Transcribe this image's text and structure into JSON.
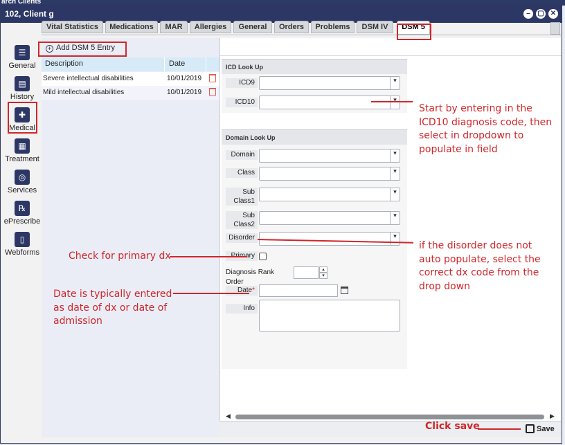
{
  "background": {
    "header_text": "arch Clients"
  },
  "window": {
    "title": "102, Client g"
  },
  "tabs": [
    {
      "label": "Vital Statistics",
      "active": false
    },
    {
      "label": "Medications",
      "active": false
    },
    {
      "label": "MAR",
      "active": false
    },
    {
      "label": "Allergies",
      "active": false
    },
    {
      "label": "General",
      "active": false
    },
    {
      "label": "Orders",
      "active": false
    },
    {
      "label": "Problems",
      "active": false
    },
    {
      "label": "DSM IV",
      "active": false
    },
    {
      "label": "DSM 5",
      "active": true
    }
  ],
  "sidebar": {
    "items": [
      {
        "label": "General",
        "icon": "person-list-icon"
      },
      {
        "label": "History",
        "icon": "clipboard-icon"
      },
      {
        "label": "Medical",
        "icon": "plus-icon"
      },
      {
        "label": "Treatment",
        "icon": "id-card-icon"
      },
      {
        "label": "Services",
        "icon": "compass-icon"
      },
      {
        "label": "ePrescribe",
        "icon": "rx-icon"
      },
      {
        "label": "Webforms",
        "icon": "document-icon"
      }
    ],
    "icon_glyphs": [
      "☰",
      "▤",
      "✚",
      "▦",
      "◎",
      "℞",
      "▯"
    ],
    "active_index": 2
  },
  "list": {
    "add_label": "Add DSM 5 Entry",
    "columns": [
      "Description",
      "Date"
    ],
    "rows": [
      {
        "description": "Severe intellectual disabilities",
        "date": "10/01/2019"
      },
      {
        "description": "Mild intellectual disabilities",
        "date": "10/01/2019"
      }
    ]
  },
  "icd_section": {
    "title": "ICD Look Up",
    "icd9_label": "ICD9",
    "icd10_label": "ICD10"
  },
  "domain_section": {
    "title": "Domain Look Up",
    "domain_label": "Domain",
    "class_label": "Class",
    "subclass1_label_line1": "Sub",
    "subclass1_label_line2": "Class1",
    "subclass2_label_line1": "Sub",
    "subclass2_label_line2": "Class2",
    "disorder_label": "Disorder",
    "primary_label": "Primary",
    "rank_label": "Diagnosis Rank Order",
    "date_label": "Date",
    "date_required": "*",
    "info_label": "Info"
  },
  "footer": {
    "save_label": "Save"
  },
  "annotations": {
    "icd10_line1": "Start by entering in the",
    "icd10_line2": "ICD10 diagnosis code, then",
    "icd10_line3": "select in dropdown to",
    "icd10_line4": "populate in field",
    "disorder_line1": "if the disorder does not",
    "disorder_line2": "auto populate, select the",
    "disorder_line3": "correct dx code from the",
    "disorder_line4": "drop down",
    "primary": "Check for primary dx",
    "date_line1": "Date is typically entered",
    "date_line2": "as date of dx or date of",
    "date_line3": "admission",
    "save": "Click save"
  },
  "colors": {
    "accent": "#2c3766",
    "annotation": "#d0262a",
    "grid_header": "#d6ebf7"
  }
}
